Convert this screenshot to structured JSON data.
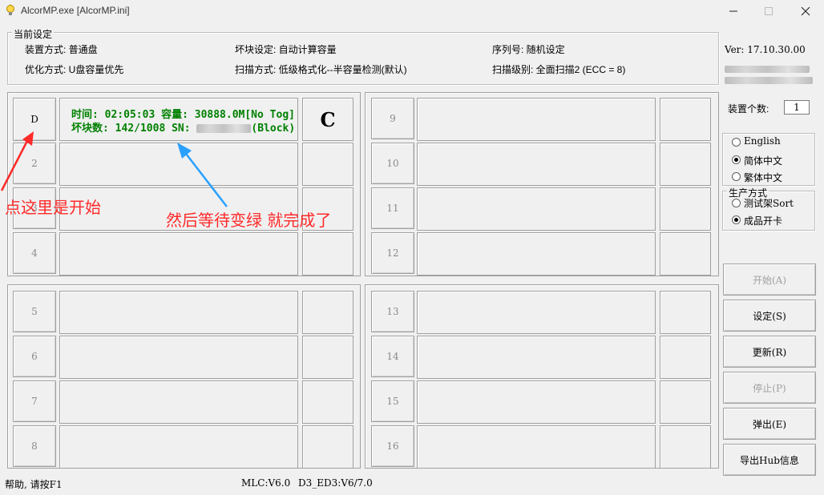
{
  "window": {
    "title": "AlcorMP.exe [AlcorMP.ini]",
    "icon": "lightbulb-icon",
    "controls": [
      "minimize-icon",
      "maximize-icon",
      "close-icon"
    ]
  },
  "settings": {
    "group_label": "当前设定",
    "device_mode": "装置方式: 普通盘",
    "optimize_mode": "优化方式: U盘容量优先",
    "bad_block": "坏块设定: 自动计算容量",
    "scan_mode": "扫描方式: 低级格式化--半容量检测(默认)",
    "serial": "序列号: 随机设定",
    "scan_level": "扫描级别: 全面扫描2 (ECC = 8)"
  },
  "version": "Ver: 17.10.30.00",
  "device_count_label": "装置个数:",
  "device_count_value": "1",
  "language": {
    "options": [
      "English",
      "简体中文",
      "繁体中文"
    ],
    "selected": "简体中文"
  },
  "production": {
    "label": "生产方式",
    "options": [
      "测试架Sort",
      "成品开卡"
    ],
    "selected": "成品开卡"
  },
  "buttons": {
    "start": "开始(A)",
    "settings": "设定(S)",
    "refresh": "更新(R)",
    "stop": "停止(P)",
    "eject": "弹出(E)",
    "export_hub": "导出Hub信息"
  },
  "ports": {
    "active": {
      "drive": "D",
      "line1": "时间: 02:05:03 容量: 30888.0M[No Tog]",
      "line2_prefix": "坏块数: 142/1008 SN: ",
      "line2_suffix": "(Block)",
      "state": "C",
      "status_color": "#008000"
    },
    "labels": [
      "2",
      "3",
      "4",
      "5",
      "6",
      "7",
      "8",
      "9",
      "10",
      "11",
      "12",
      "13",
      "14",
      "15",
      "16"
    ]
  },
  "annotations": {
    "click_here": "点这里是开始",
    "wait_green": "然后等待变绿 就完成了",
    "color": "#ff2a2a"
  },
  "statusbar": {
    "help": "帮助, 请按F1",
    "mlc": "MLC:V6.0",
    "ed3": "D3_ED3:V6/7.0"
  }
}
